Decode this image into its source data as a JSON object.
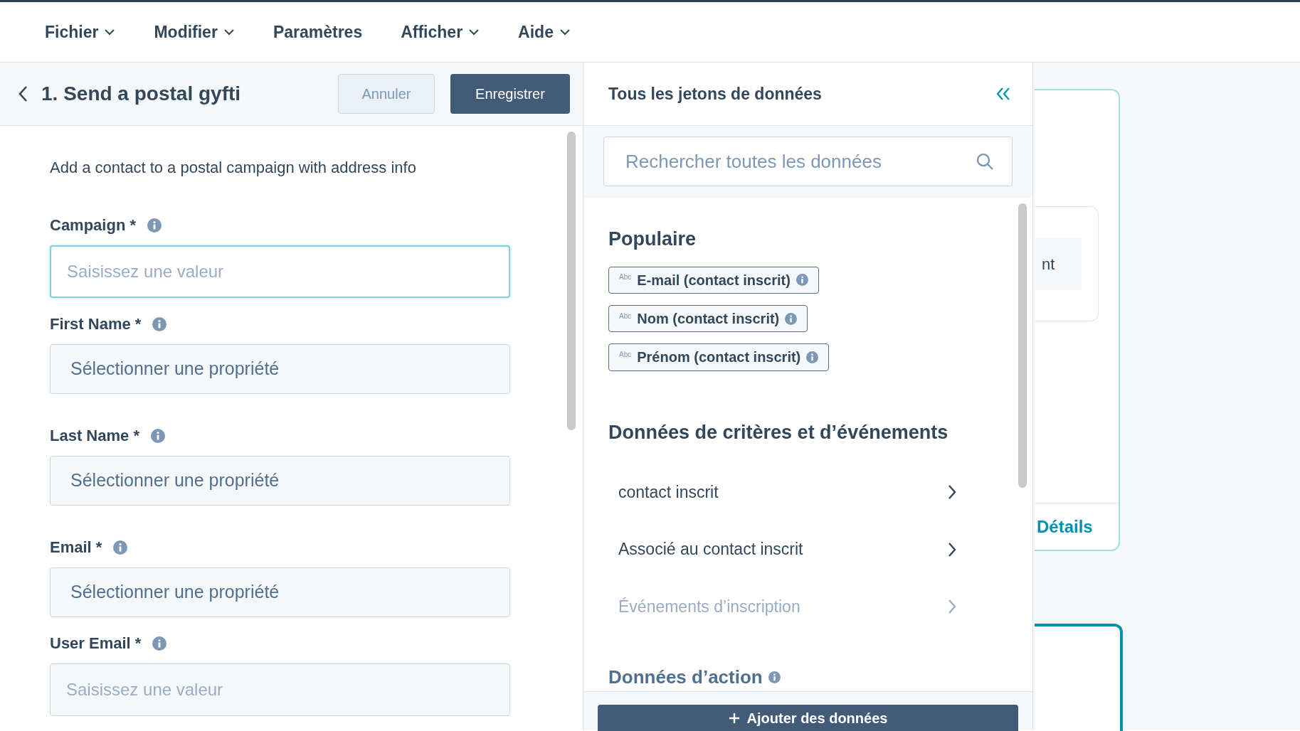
{
  "menu": [
    {
      "label": "Fichier",
      "has_caret": true
    },
    {
      "label": "Modifier",
      "has_caret": true
    },
    {
      "label": "Paramètres",
      "has_caret": false
    },
    {
      "label": "Afficher",
      "has_caret": true
    },
    {
      "label": "Aide",
      "has_caret": true
    }
  ],
  "editor": {
    "title": "1. Send a postal gyfti",
    "cancel": "Annuler",
    "save": "Enregistrer",
    "description": "Add a contact to a postal campaign with address info",
    "fields": [
      {
        "label": "Campaign *",
        "kind": "input",
        "placeholder": "Saisissez une valeur",
        "focused": true
      },
      {
        "label": "First Name *",
        "kind": "select",
        "placeholder": "Sélectionner une propriété",
        "focused": false
      },
      {
        "label": "Last Name *",
        "kind": "select",
        "placeholder": "Sélectionner une propriété",
        "focused": false
      },
      {
        "label": "Email *",
        "kind": "select",
        "placeholder": "Sélectionner une propriété",
        "focused": false
      },
      {
        "label": "User Email *",
        "kind": "input",
        "placeholder": "Saisissez une valeur",
        "focused": false
      }
    ]
  },
  "tokens_panel": {
    "title": "Tous les jetons de données",
    "search": {
      "placeholder": "Rechercher toutes les données"
    },
    "popular": {
      "heading": "Populaire",
      "tokens": [
        {
          "type_label": "Abc",
          "label": "E-mail (contact inscrit)"
        },
        {
          "type_label": "Abc",
          "label": "Nom (contact inscrit)"
        },
        {
          "type_label": "Abc",
          "label": "Prénom (contact inscrit)"
        }
      ]
    },
    "criteria": {
      "heading": "Données de critères et d’événements",
      "items": [
        {
          "label": "contact inscrit",
          "disabled": false
        },
        {
          "label": "Associé au contact inscrit",
          "disabled": false
        },
        {
          "label": "Événements d’inscription",
          "disabled": true
        }
      ]
    },
    "action_heading": "Données d’action",
    "add_button": "Ajouter des données"
  },
  "canvas": {
    "card_text": "nt",
    "details_link": "Détails"
  }
}
